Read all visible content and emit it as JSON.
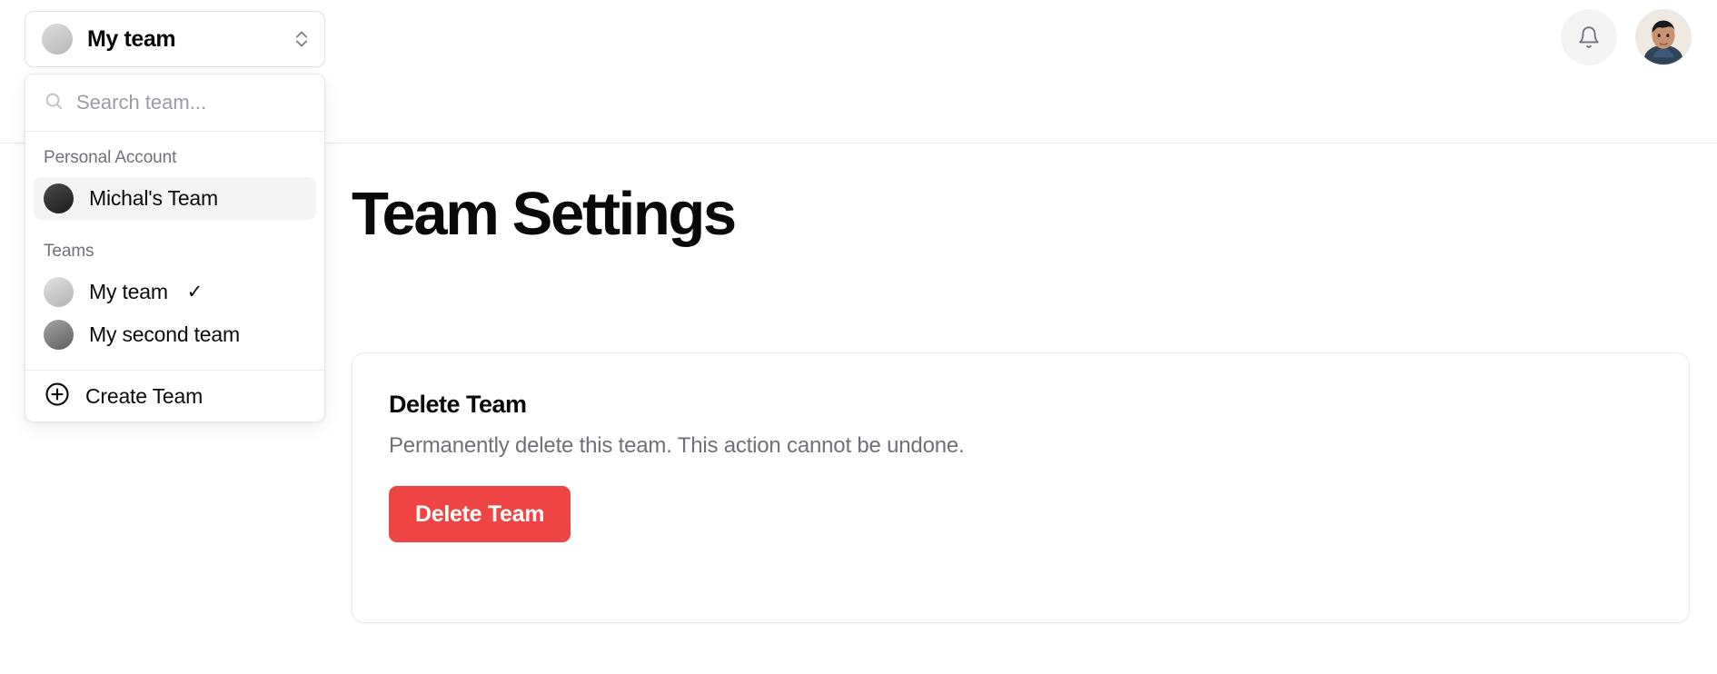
{
  "header": {
    "notifications_icon": "bell-icon",
    "avatar_alt": "user-avatar"
  },
  "team_switcher": {
    "current_team": "My team",
    "chevron_icon": "chevron-up-down-icon",
    "avatar_style": "light"
  },
  "dropdown": {
    "search": {
      "placeholder": "Search team...",
      "value": "",
      "icon": "search-icon"
    },
    "groups": [
      {
        "label": "Personal Account",
        "items": [
          {
            "name": "Michal's Team",
            "avatar": "dark",
            "selected": true,
            "check": ""
          }
        ]
      },
      {
        "label": "Teams",
        "items": [
          {
            "name": "My team",
            "avatar": "light",
            "selected": false,
            "check": "✓"
          },
          {
            "name": "My second team",
            "avatar": "medium",
            "selected": false,
            "check": ""
          }
        ]
      }
    ],
    "create": {
      "label": "Create Team",
      "icon": "plus-circle-icon"
    }
  },
  "main": {
    "title": "Team Settings",
    "danger_card": {
      "title": "Delete Team",
      "description": "Permanently delete this team. This action cannot be undone.",
      "button_label": "Delete Team",
      "button_color": "#ef4444"
    }
  }
}
